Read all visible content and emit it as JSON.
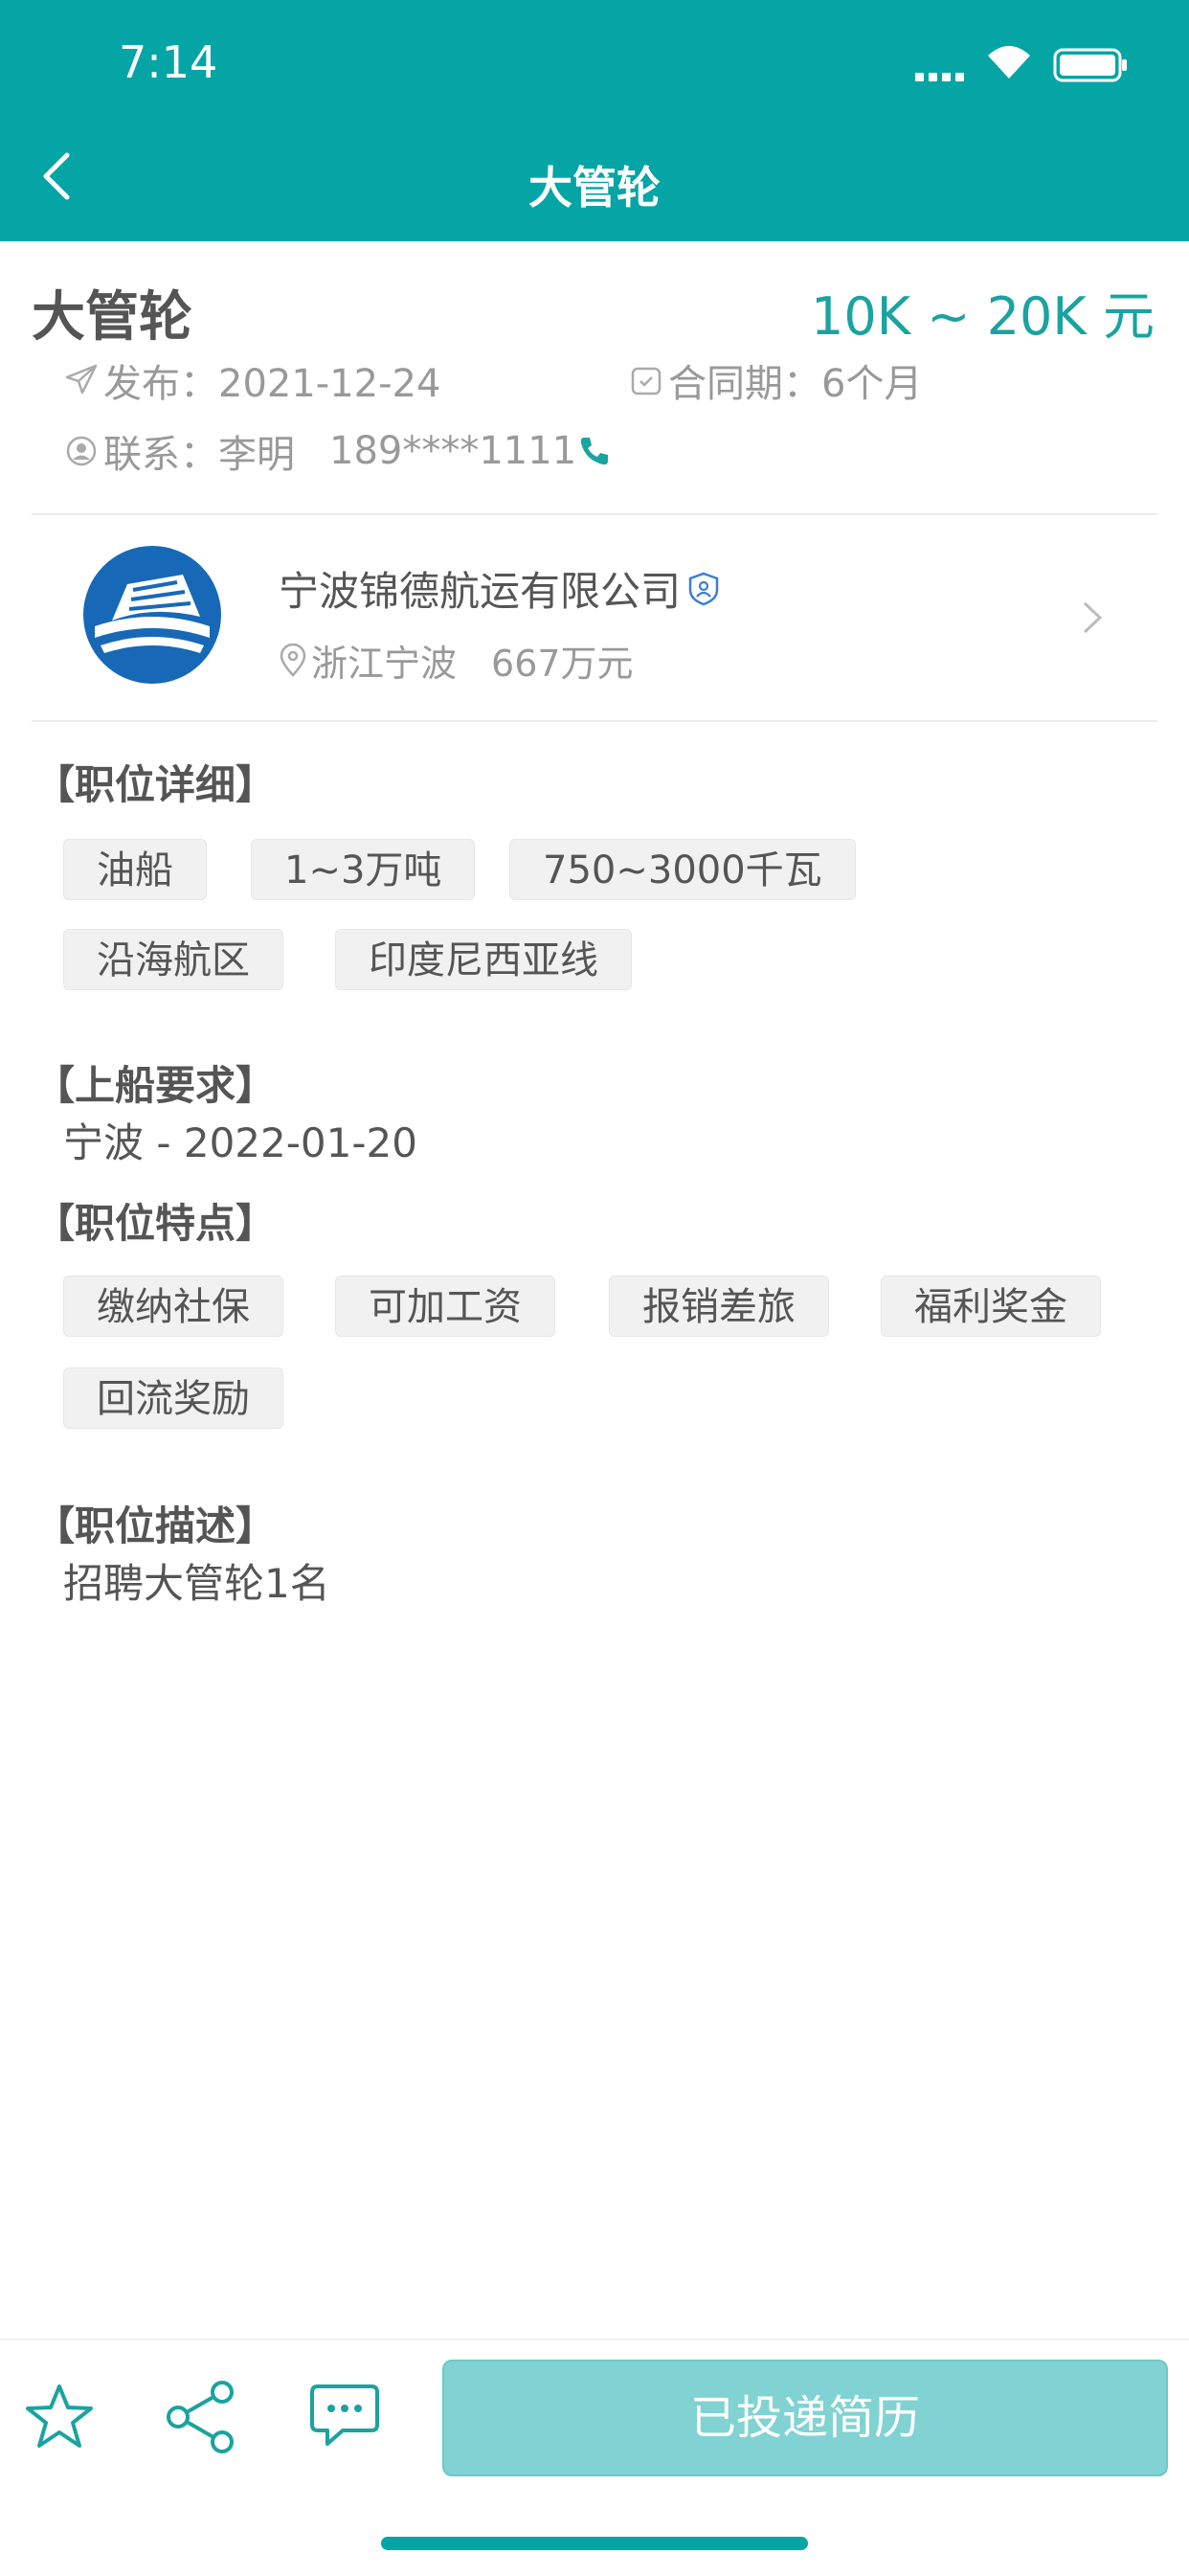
{
  "status_bar": {
    "time": "7:14"
  },
  "nav": {
    "title": "大管轮"
  },
  "job": {
    "title": "大管轮",
    "salary": "10K ~ 20K 元",
    "published": "发布：2021-12-24",
    "contract": "合同期：6个月",
    "contact": "联系：李明",
    "phone": "189****1111"
  },
  "company": {
    "name": "宁波锦德航运有限公司",
    "location": "浙江宁波",
    "capital": "667万元"
  },
  "sections": {
    "details_title": "【职位详细】",
    "details_tags": [
      "油船",
      "1~3万吨",
      "750~3000千瓦",
      "沿海航区",
      "印度尼西亚线"
    ],
    "boarding_title": "【上船要求】",
    "boarding_text": "宁波 - 2022-01-20",
    "features_title": "【职位特点】",
    "features_tags": [
      "缴纳社保",
      "可加工资",
      "报销差旅",
      "福利奖金",
      "回流奖励"
    ],
    "description_title": "【职位描述】",
    "description_text": "招聘大管轮1名"
  },
  "bottom": {
    "apply_label": "已投递简历"
  },
  "colors": {
    "primary": "#05a5a5",
    "salary": "#1aa3a0",
    "button": "#80d3d2"
  }
}
